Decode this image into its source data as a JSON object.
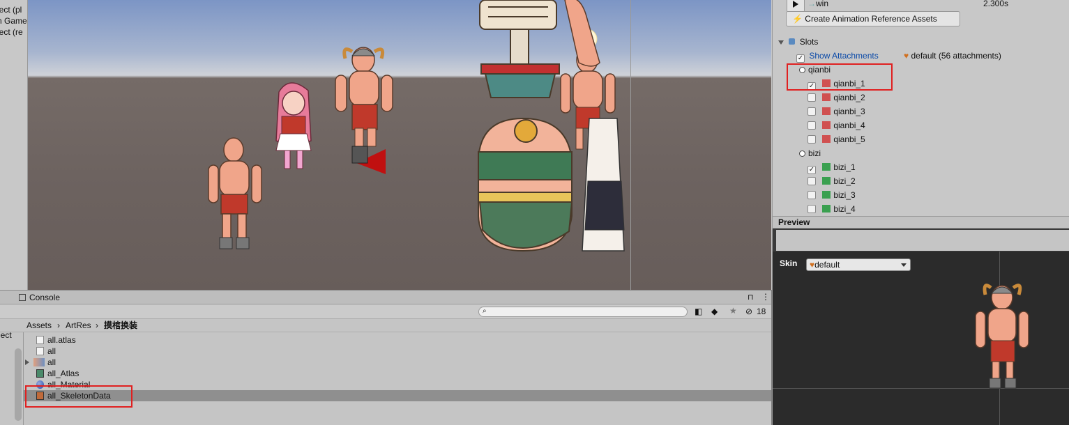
{
  "hierarchy": {
    "rows": [
      "ject (pl",
      "n Game",
      "ject (re"
    ]
  },
  "inspector": {
    "animation_name": "win",
    "animation_duration": "2.300s",
    "create_button": "Create Animation Reference Assets",
    "slots_label": "Slots",
    "show_attachments_label": "Show Attachments",
    "default_skin_info": "default (56 attachments)",
    "slots": [
      {
        "name": "qianbi",
        "attachments": [
          {
            "label": "qianbi_1",
            "checked": true
          },
          {
            "label": "qianbi_2",
            "checked": false
          },
          {
            "label": "qianbi_3",
            "checked": false
          },
          {
            "label": "qianbi_4",
            "checked": false
          },
          {
            "label": "qianbi_5",
            "checked": false
          }
        ]
      },
      {
        "name": "bizi",
        "attachments": [
          {
            "label": "bizi_1",
            "checked": true
          },
          {
            "label": "bizi_2",
            "checked": false
          },
          {
            "label": "bizi_3",
            "checked": false
          },
          {
            "label": "bizi_4",
            "checked": false
          }
        ]
      }
    ]
  },
  "preview": {
    "title": "Preview",
    "skin_label": "Skin",
    "skin_value": "default"
  },
  "console": {
    "tab_label": "Console",
    "hidden_count": "18",
    "left_partial": "ject"
  },
  "project": {
    "breadcrumb": [
      "Assets",
      "ArtRes",
      "摸棺换装"
    ],
    "files": [
      {
        "name": "all.atlas",
        "icon": "text-file-icon"
      },
      {
        "name": "all",
        "icon": "text-file-icon"
      },
      {
        "name": "all",
        "icon": "texture-icon"
      },
      {
        "name": "all_Atlas",
        "icon": "atlas-asset-icon"
      },
      {
        "name": "all_Material",
        "icon": "material-icon"
      },
      {
        "name": "all_SkeletonData",
        "icon": "skeleton-data-icon"
      }
    ],
    "selected_file": "all_SkeletonData"
  },
  "colors": {
    "highlight_red": "#e02020",
    "link_blue": "#0b4aa8"
  }
}
